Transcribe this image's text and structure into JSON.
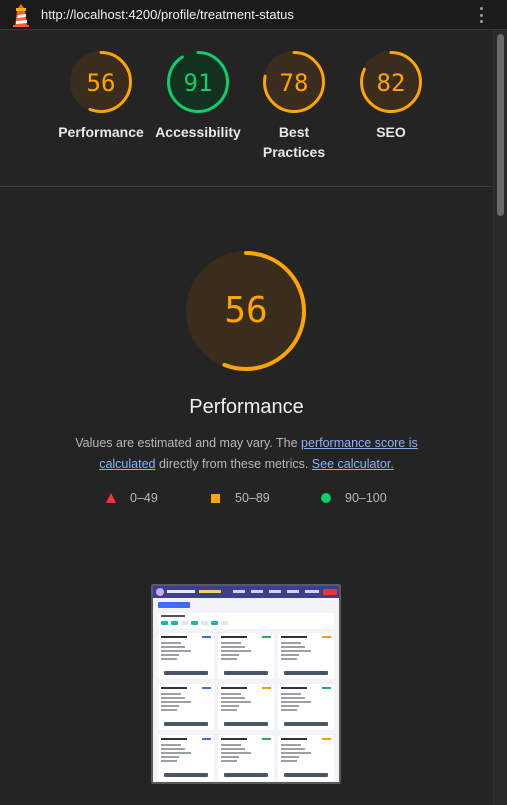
{
  "topbar": {
    "url": "http://localhost:4200/profile/treatment-status"
  },
  "summary": [
    {
      "label": "Performance",
      "score": "56",
      "value": 56,
      "color": "#ffa400"
    },
    {
      "label": "Accessibility",
      "score": "91",
      "value": 91,
      "color": "#0cce6b"
    },
    {
      "label": "Best Practices",
      "score": "78",
      "value": 78,
      "color": "#ffa400"
    },
    {
      "label": "SEO",
      "score": "82",
      "value": 82,
      "color": "#ffa400"
    }
  ],
  "main": {
    "score": "56",
    "value": 56,
    "title": "Performance",
    "desc_prefix": "Values are estimated and may vary. The ",
    "desc_link1": "performance score is calculated",
    "desc_mid": " directly from these metrics. ",
    "desc_link2": "See calculator."
  },
  "legend": [
    {
      "range": "0–49",
      "color": "#ff3333"
    },
    {
      "range": "50–89",
      "color": "#ffa400"
    },
    {
      "range": "90–100",
      "color": "#0cce6b"
    }
  ],
  "colors": {
    "fail": "#ff3333",
    "average": "#ffa400",
    "pass": "#0cce6b",
    "link": "#8ab4f8"
  }
}
